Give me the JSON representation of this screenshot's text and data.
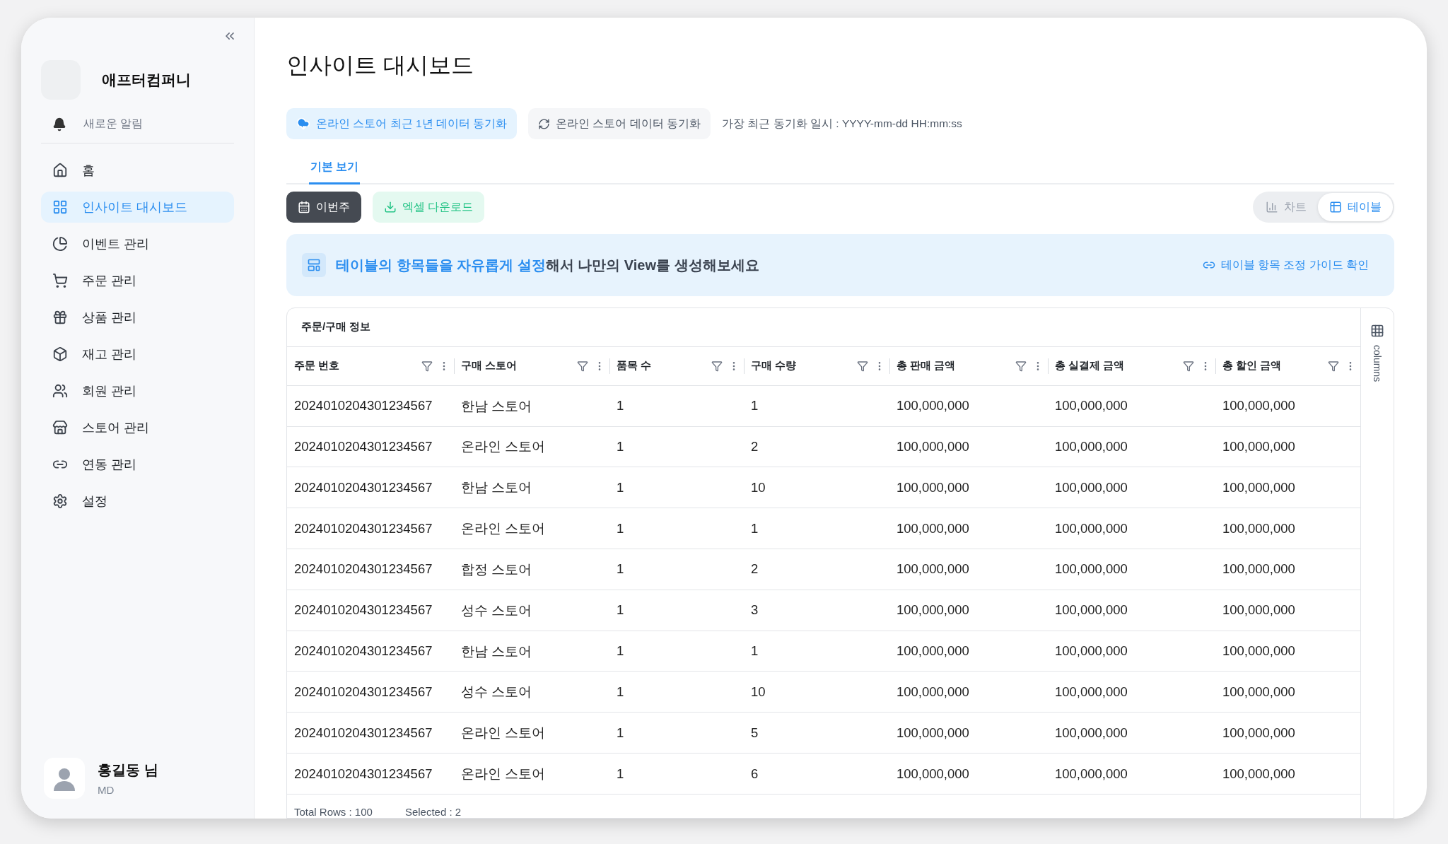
{
  "sidebar": {
    "company": "애프터컴퍼니",
    "notification": "새로운 알림",
    "items": [
      {
        "label": "홈",
        "selected": false
      },
      {
        "label": "인사이트 대시보드",
        "selected": true
      },
      {
        "label": "이벤트 관리",
        "selected": false
      },
      {
        "label": "주문 관리",
        "selected": false
      },
      {
        "label": "상품 관리",
        "selected": false
      },
      {
        "label": "재고 관리",
        "selected": false
      },
      {
        "label": "회원 관리",
        "selected": false
      },
      {
        "label": "스토어 관리",
        "selected": false
      },
      {
        "label": "연동 관리",
        "selected": false
      },
      {
        "label": "설정",
        "selected": false
      }
    ],
    "user": {
      "name": "홍길동 님",
      "role": "MD"
    }
  },
  "page_title": "인사이트 대시보드",
  "sync_buttons": [
    {
      "label": "온라인 스토어 최근 1년 데이터 동기화",
      "kind": "primary"
    },
    {
      "label": "온라인 스토어 데이터 동기화",
      "kind": "secondary"
    }
  ],
  "last_sync": "가장 최근 동기화 일시 : YYYY-mm-dd HH:mm:ss",
  "tabs": [
    {
      "label": "기본 보기",
      "selected": true
    }
  ],
  "period_button": "이번주",
  "excel_button": "엑셀 다운로드",
  "view_toggle": [
    {
      "label": "차트",
      "selected": false
    },
    {
      "label": "테이블",
      "selected": true
    }
  ],
  "banner": {
    "text": "**테이블의 항목들을 자유롭게 설정**해서 나만의 View를 생성해보세요",
    "link": "테이블 항목 조정 가이드 확인"
  },
  "table": {
    "group": "주문/구매 정보",
    "columns_label": "columns",
    "columns": [
      "주문 번호",
      "구매 스토어",
      "품목 수",
      "구매 수량",
      "총 판매 금액",
      "총 실결제 금액",
      "총 할인 금액"
    ],
    "rows": [
      [
        "2024010204301234567",
        "한남 스토어",
        "1",
        "1",
        "100,000,000",
        "100,000,000",
        "100,000,000"
      ],
      [
        "2024010204301234567",
        "온라인 스토어",
        "1",
        "2",
        "100,000,000",
        "100,000,000",
        "100,000,000"
      ],
      [
        "2024010204301234567",
        "한남 스토어",
        "1",
        "10",
        "100,000,000",
        "100,000,000",
        "100,000,000"
      ],
      [
        "2024010204301234567",
        "온라인 스토어",
        "1",
        "1",
        "100,000,000",
        "100,000,000",
        "100,000,000"
      ],
      [
        "2024010204301234567",
        "합정 스토어",
        "1",
        "2",
        "100,000,000",
        "100,000,000",
        "100,000,000"
      ],
      [
        "2024010204301234567",
        "성수 스토어",
        "1",
        "3",
        "100,000,000",
        "100,000,000",
        "100,000,000"
      ],
      [
        "2024010204301234567",
        "한남 스토어",
        "1",
        "1",
        "100,000,000",
        "100,000,000",
        "100,000,000"
      ],
      [
        "2024010204301234567",
        "성수 스토어",
        "1",
        "10",
        "100,000,000",
        "100,000,000",
        "100,000,000"
      ],
      [
        "2024010204301234567",
        "온라인 스토어",
        "1",
        "5",
        "100,000,000",
        "100,000,000",
        "100,000,000"
      ],
      [
        "2024010204301234567",
        "온라인 스토어",
        "1",
        "6",
        "100,000,000",
        "100,000,000",
        "100,000,000"
      ]
    ],
    "total_rows": "Total Rows : 100",
    "selected": "Selected : 2"
  }
}
